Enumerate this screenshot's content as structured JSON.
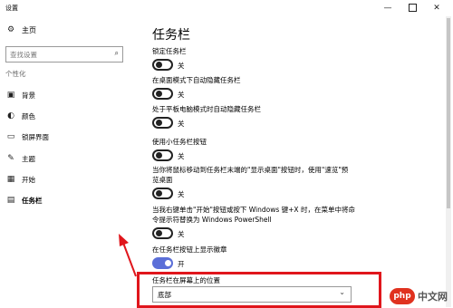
{
  "window": {
    "title": "设置"
  },
  "sidebar": {
    "home": "主页",
    "search_placeholder": "查找设置",
    "section": "个性化",
    "items": [
      {
        "label": "背景",
        "icon": "image-icon"
      },
      {
        "label": "颜色",
        "icon": "palette-icon"
      },
      {
        "label": "锁屏界面",
        "icon": "lockscreen-icon"
      },
      {
        "label": "主题",
        "icon": "brush-icon"
      },
      {
        "label": "开始",
        "icon": "start-icon"
      },
      {
        "label": "任务栏",
        "icon": "taskbar-icon",
        "active": true
      }
    ]
  },
  "main": {
    "title": "任务栏",
    "settings": [
      {
        "label": "锁定任务栏",
        "state": "关",
        "on": false
      },
      {
        "label": "在桌面模式下自动隐藏任务栏",
        "state": "关",
        "on": false
      },
      {
        "label": "处于平板电脑模式时自动隐藏任务栏",
        "state": "关",
        "on": false
      },
      {
        "label": "使用小任务栏按钮",
        "state": "关",
        "on": false
      },
      {
        "label_line1": "当你将鼠标移动到任务栏末端的\"显示桌面\"按钮时，使用\"速览\"预",
        "label_line2": "览桌面",
        "state": "关",
        "on": false
      },
      {
        "label_line1": "当我右键单击\"开始\"按钮或按下 Windows 键+X 时，在菜单中将命",
        "label_line2": "令提示符替换为 Windows PowerShell",
        "state": "关",
        "on": false
      },
      {
        "label": "在任务栏按钮上显示徽章",
        "state": "开",
        "on": true
      }
    ],
    "position_label": "任务栏在屏幕上的位置",
    "position_value": "底部"
  },
  "watermark": {
    "badge": "php",
    "text": "中文网"
  },
  "colors": {
    "accent": "#5b6fd8",
    "highlight": "#e0161c"
  }
}
